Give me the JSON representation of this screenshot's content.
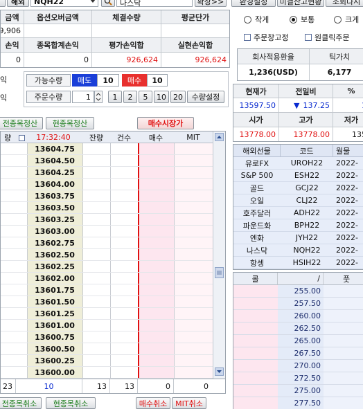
{
  "top_bar": {
    "overseas_btn": "해외",
    "symbol_value": "NQH22",
    "symbol_name": "나스닥",
    "more_btn": "확장>>",
    "right_tabs": [
      "환경설정",
      "미결잔고현황",
      "조회다시"
    ]
  },
  "summary": {
    "headers": [
      "금액",
      "옵션오버금액",
      "체결수량",
      "평균단가"
    ],
    "row1": [
      "9,906",
      "",
      "",
      ""
    ],
    "headers2": [
      "손익",
      "종목합계손익",
      "평가손익합",
      "실현손익합"
    ],
    "row2": [
      "0",
      "0",
      "926,624",
      "926,624"
    ]
  },
  "order_panel": {
    "side_label": "익",
    "qty_label": "가능수량",
    "sell_label": "매도",
    "sell_qty": "10",
    "buy_label": "매수",
    "buy_qty": "10",
    "order_qty_label": "주문수량",
    "order_qty_value": "1",
    "qty_buttons": [
      "1",
      "2",
      "5",
      "10",
      "20"
    ],
    "qty_setting": "수량설정"
  },
  "actions": {
    "close_all": "전종목청산",
    "close_current": "현종목청산",
    "market_buy": "매수시장가",
    "cancel_all": "전종목취소",
    "cancel_current": "현종목취소",
    "cancel_buy": "매수취소",
    "cancel_mit": "MIT취소"
  },
  "ladder": {
    "headers": [
      "량",
      "17:32:40",
      "잔량",
      "건수",
      "매수",
      "MIT"
    ],
    "prices": [
      "13604.75",
      "13604.50",
      "13604.25",
      "13604.00",
      "13603.75",
      "13603.50",
      "13603.25",
      "13603.00",
      "13602.75",
      "13602.50",
      "13602.25",
      "13602.00",
      "13601.75",
      "13601.50",
      "13601.25",
      "13601.00",
      "13600.75",
      "13600.50",
      "13600.25",
      "13600.00"
    ],
    "footer": [
      "23",
      "10",
      "13",
      "13",
      "0",
      "0"
    ]
  },
  "options": {
    "size_options": [
      "작게",
      "보통",
      "크게"
    ],
    "size_selected": 1,
    "fix_window": "주문창고정",
    "one_click": "원클릭주문"
  },
  "fx": {
    "header_label": "회사적용환율",
    "header_tick": "틱가치",
    "rate": "1,236(USD)",
    "tick_value": "6,177"
  },
  "quote": {
    "headers": [
      "현재가",
      "전일비",
      "%"
    ],
    "values": [
      "13597.50",
      "137.25",
      "1"
    ],
    "change_dir": "▼",
    "headers2": [
      "시가",
      "고가",
      "저가"
    ],
    "values2": [
      "13778.00",
      "13778.00",
      "135"
    ]
  },
  "futures_list": {
    "headers": [
      "해외선물",
      "코드",
      "월물"
    ],
    "rows": [
      {
        "name": "유로FX",
        "code": "UROH22",
        "month": "2022-"
      },
      {
        "name": "S&P 500",
        "code": "ESH22",
        "month": "2022-"
      },
      {
        "name": "골드",
        "code": "GCJ22",
        "month": "2022-"
      },
      {
        "name": "오일",
        "code": "CLJ22",
        "month": "2022-"
      },
      {
        "name": "호주달러",
        "code": "ADH22",
        "month": "2022-"
      },
      {
        "name": "파운드화",
        "code": "BPH22",
        "month": "2022-"
      },
      {
        "name": "엔화",
        "code": "JYH22",
        "month": "2022-"
      },
      {
        "name": "나스닥",
        "code": "NQH22",
        "month": "2022-"
      },
      {
        "name": "항셍",
        "code": "HSIH22",
        "month": "2022-"
      }
    ]
  },
  "option_ladder": {
    "headers": [
      "콜",
      "/",
      "풋"
    ],
    "strikes": [
      "255.00",
      "257.50",
      "260.00",
      "262.50",
      "265.00",
      "267.50",
      "270.00",
      "272.50",
      "275.00",
      "277.50"
    ]
  },
  "colors": {
    "accent_blue": "#0a2bd0",
    "accent_red": "#e01010",
    "sell_bg": "#1a3fd8",
    "buy_bg": "#e8302e",
    "price_bg": "#efeed8",
    "buy_col_bg": "#fde6ef",
    "list_bg": "#e7edf9"
  }
}
